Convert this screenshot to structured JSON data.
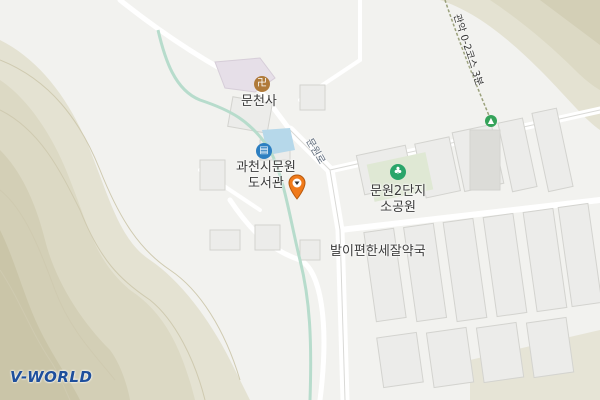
{
  "map": {
    "places": {
      "temple": {
        "label": "문천사",
        "icon": "temple-icon",
        "color": "#b07a3a"
      },
      "library": {
        "label": "과천시문원\n도서관",
        "icon": "library-icon",
        "color": "#2d7fc1"
      },
      "park": {
        "label": "문원2단지\n소공원",
        "icon": "park-icon",
        "color": "#2aa56a"
      },
      "pharmacy": {
        "label": "발이편한세잘약국"
      }
    },
    "roads": {
      "munwon_ro": "문원로"
    },
    "trail": {
      "label": "관악 0-2코스 3분",
      "icon": "trail-marker-icon",
      "color": "#35a35a"
    },
    "location_marker": {
      "icon": "location-pin-icon",
      "color": "#f07a1a"
    },
    "logo": "V-WORLD"
  }
}
